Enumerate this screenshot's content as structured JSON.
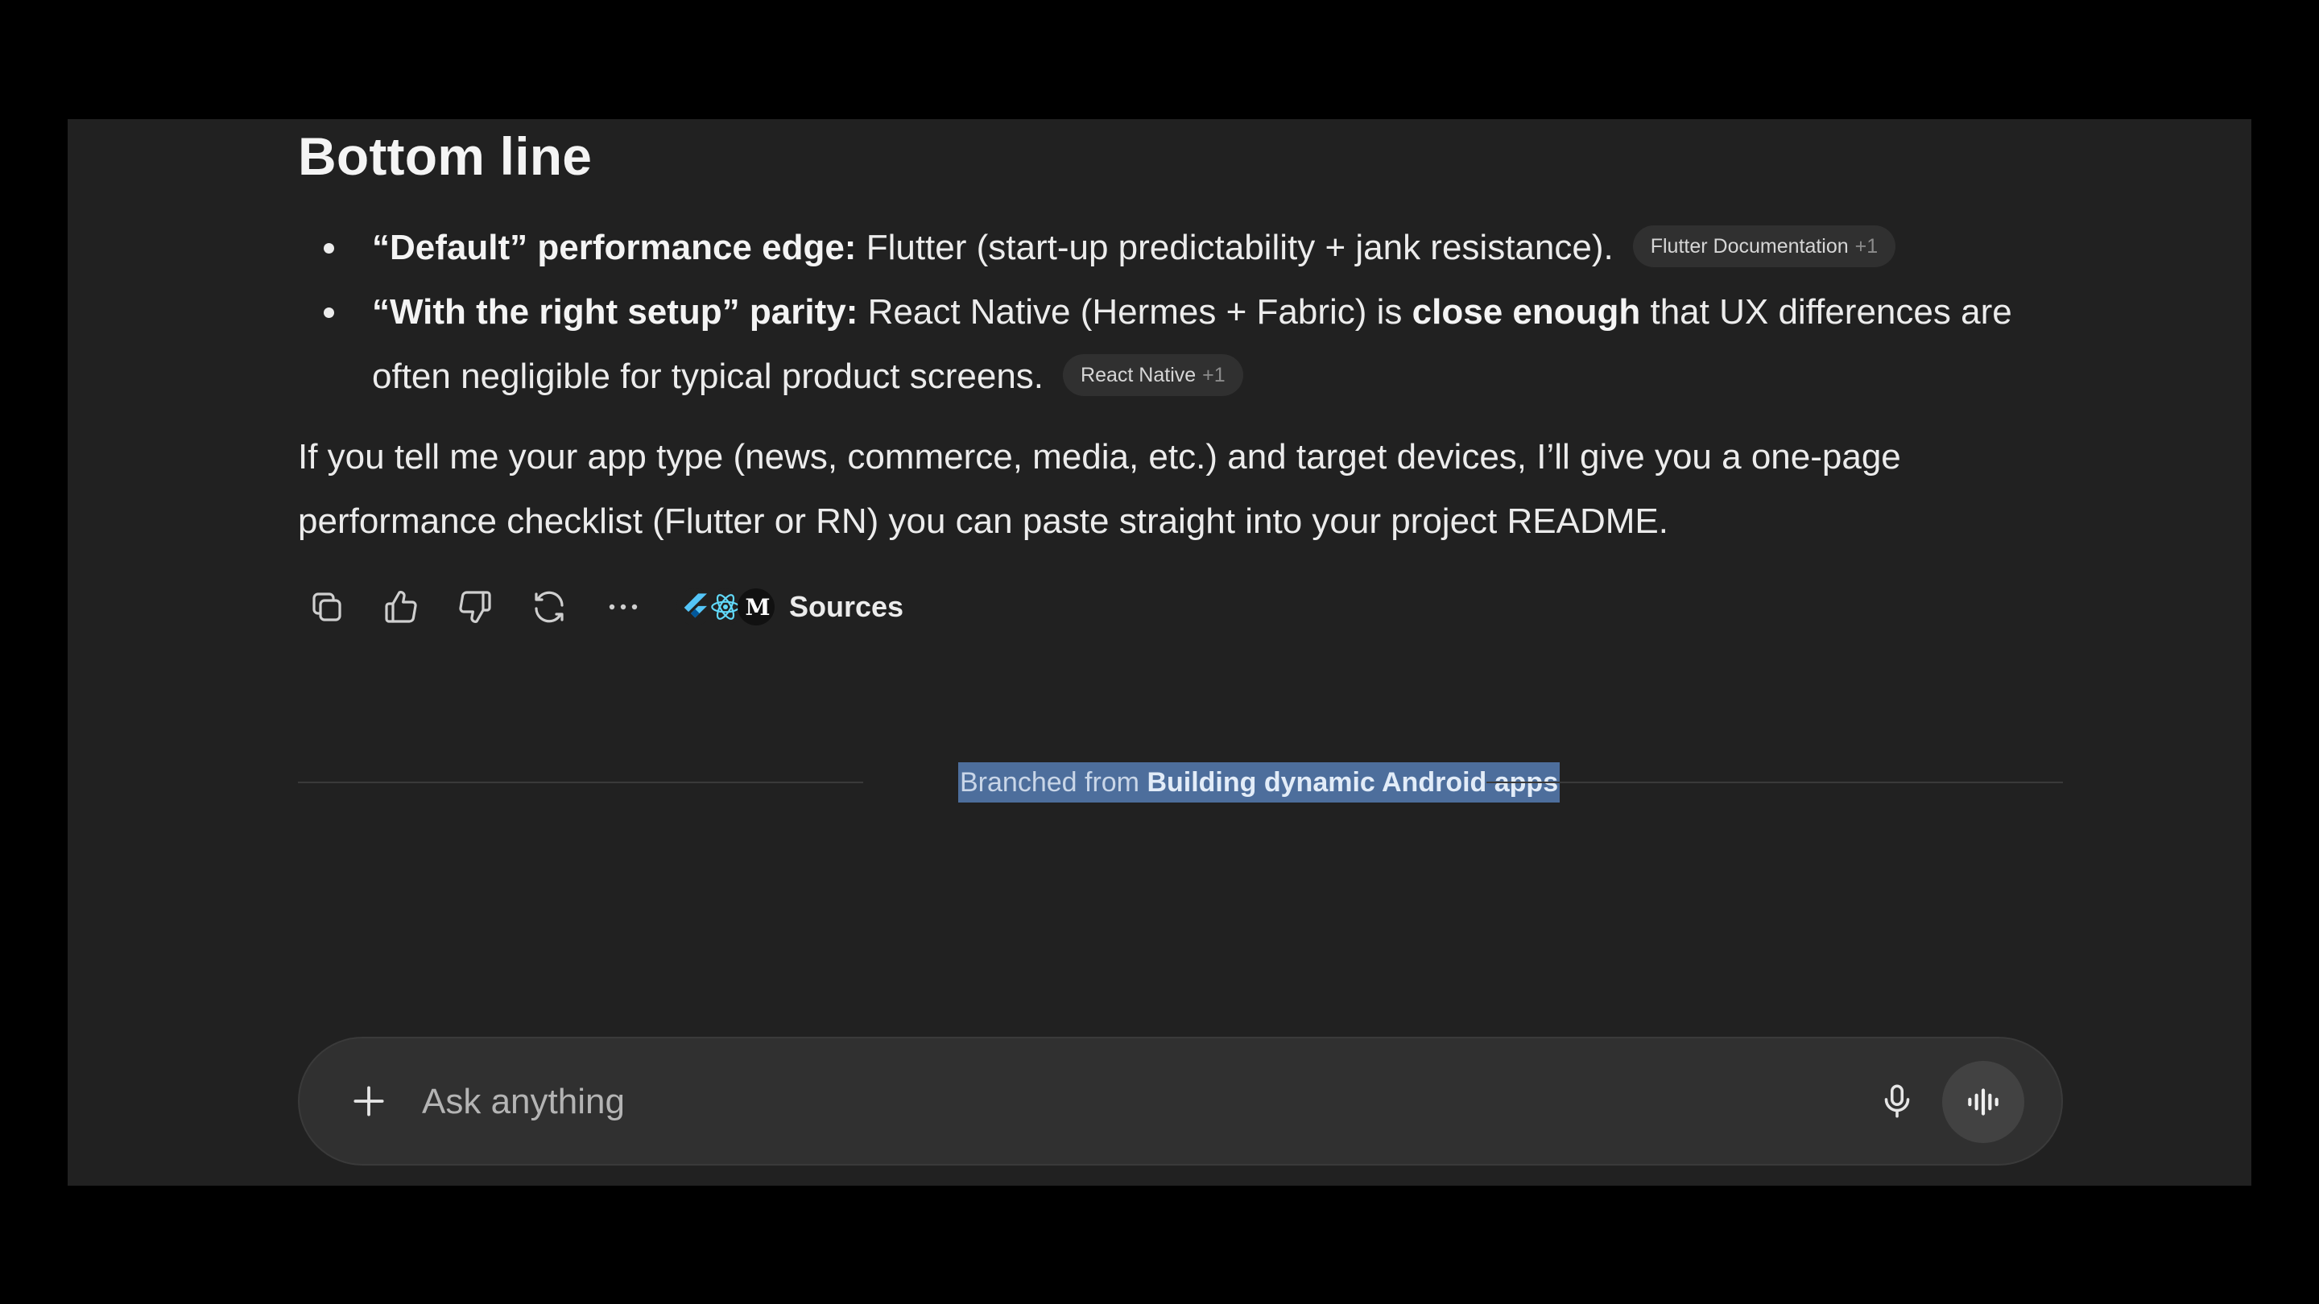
{
  "answer": {
    "heading": "Bottom line",
    "bullets": [
      {
        "label": "“Default” performance edge:",
        "text": " Flutter (start-up predictability + jank resistance).",
        "citation": {
          "label": "Flutter Documentation",
          "count": "+1"
        }
      },
      {
        "label": "“With the right setup” parity:",
        "text_before": " React Native (Hermes + Fabric) is ",
        "emphasis": "close enough",
        "text_after": " that UX differences are often negligible for typical product screens.",
        "citation": {
          "label": "React Native",
          "count": "+1"
        }
      }
    ],
    "paragraph": "If you tell me your app type (news, commerce, media, etc.) and target devices, I’ll give you a one-page performance checklist (Flutter or RN) you can paste straight into your project README."
  },
  "actions": {
    "items": [
      {
        "name": "copy-button",
        "icon": "copy-icon"
      },
      {
        "name": "thumbs-up-button",
        "icon": "thumbs-up-icon"
      },
      {
        "name": "thumbs-down-button",
        "icon": "thumbs-down-icon"
      },
      {
        "name": "regenerate-button",
        "icon": "refresh-icon"
      },
      {
        "name": "more-button",
        "icon": "more-horizontal-icon"
      }
    ],
    "sources_label": "Sources",
    "source_icons": [
      "flutter-icon",
      "react-icon",
      "medium-icon"
    ],
    "medium_letter": "M"
  },
  "branch": {
    "prefix": "Branched from ",
    "title": "Building dynamic Android apps"
  },
  "composer": {
    "placeholder": "Ask anything",
    "value": ""
  },
  "colors": {
    "background": "#000000",
    "panel": "#212121",
    "composer": "#303030",
    "text": "#ececec",
    "selection": "#4d6e9c"
  }
}
